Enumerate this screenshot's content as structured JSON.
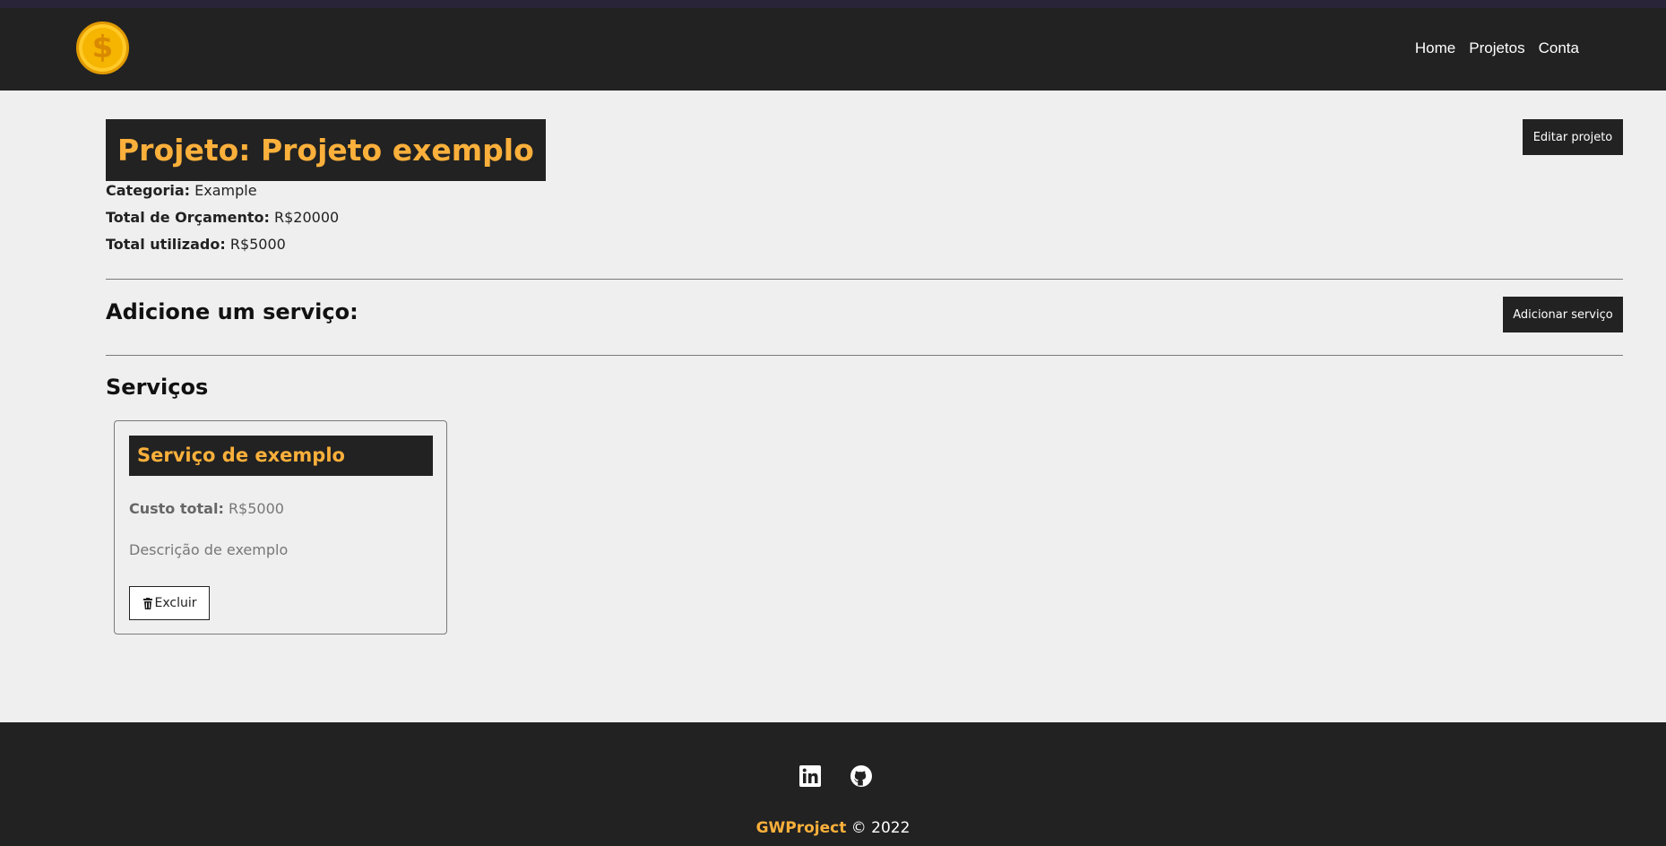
{
  "header": {
    "logo_symbol": "$",
    "nav": [
      {
        "label": "Home"
      },
      {
        "label": "Projetos"
      },
      {
        "label": "Conta"
      }
    ]
  },
  "project": {
    "title": "Projeto: Projeto exemplo",
    "edit_button": "Editar projeto",
    "category_label": "Categoria:",
    "category_value": "Example",
    "budget_label": "Total de Orçamento:",
    "budget_value": "R$20000",
    "used_label": "Total utilizado:",
    "used_value": "R$5000"
  },
  "add_service": {
    "heading": "Adicione um serviço:",
    "button": "Adicionar serviço"
  },
  "services": {
    "heading": "Serviços",
    "items": [
      {
        "title": "Serviço de exemplo",
        "cost_label": "Custo total:",
        "cost_value": "R$5000",
        "description": "Descrição de exemplo",
        "delete_label": "Excluir"
      }
    ]
  },
  "footer": {
    "icons": [
      "linkedin-icon",
      "github-icon"
    ],
    "brand": "GWProject",
    "copyright": "© 2022"
  },
  "colors": {
    "dark": "#222222",
    "accent": "#fbb03b",
    "background": "#efefef"
  }
}
